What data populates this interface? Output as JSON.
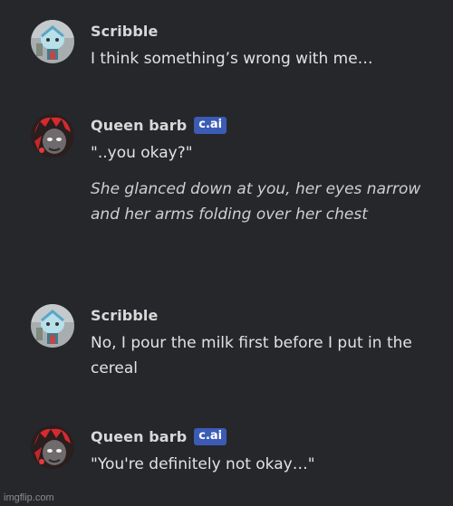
{
  "messages": [
    {
      "author": "Scribble",
      "badge": "",
      "text": "I think something’s wrong with me…",
      "italic": "",
      "avatar_icon": "scribble-avatar-icon"
    },
    {
      "author": "Queen barb",
      "badge": "c.ai",
      "text": "\"..you okay?\"",
      "italic": "She glanced down at you, her eyes narrow and her arms folding over her chest",
      "avatar_icon": "queen-barb-avatar-icon"
    },
    {
      "author": "Scribble",
      "badge": "",
      "text": "No, I pour the milk first before I put in the cereal",
      "italic": "",
      "avatar_icon": "scribble-avatar-icon"
    },
    {
      "author": "Queen barb",
      "badge": "c.ai",
      "text": "\"You're definitely not okay…\"",
      "italic": "",
      "avatar_icon": "queen-barb-avatar-icon"
    }
  ],
  "watermark": "imgflip.com",
  "colors": {
    "background": "#26272b",
    "badge": "#3b5bb5"
  }
}
